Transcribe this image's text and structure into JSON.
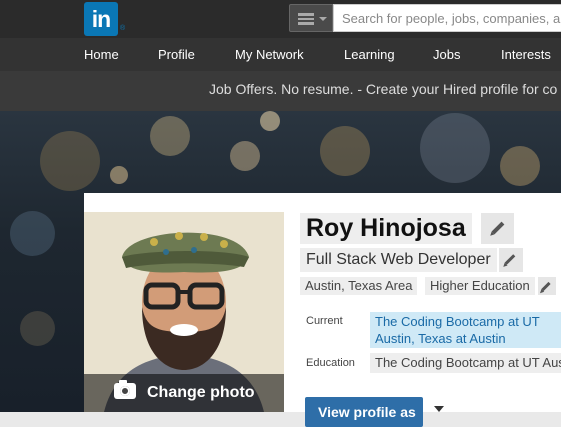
{
  "logo": {
    "text": "in",
    "registered": "®"
  },
  "search": {
    "placeholder": "Search for people, jobs, companies, a",
    "type_icon": "menu-icon"
  },
  "nav": {
    "items": [
      {
        "label": "Home"
      },
      {
        "label": "Profile"
      },
      {
        "label": "My Network"
      },
      {
        "label": "Learning"
      },
      {
        "label": "Jobs"
      },
      {
        "label": "Interests"
      }
    ]
  },
  "banner": {
    "text": "Job Offers. No resume. - Create your Hired profile for co"
  },
  "profile": {
    "name": "Roy Hinojosa",
    "headline": "Full Stack Web Developer",
    "location": "Austin, Texas Area",
    "industry": "Higher Education",
    "current_label": "Current",
    "current_value": "The Coding Bootcamp at UT Austin, Texas at Austin",
    "education_label": "Education",
    "education_value": "The Coding Bootcamp at UT Aus",
    "change_photo": "Change photo",
    "view_profile": "View profile as"
  },
  "colors": {
    "linkedin_blue": "#0a77b5",
    "current_highlight": "#cfe9f6",
    "button_blue": "#2e6ea8"
  }
}
